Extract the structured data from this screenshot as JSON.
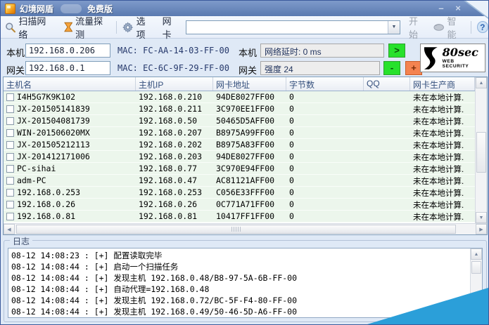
{
  "window": {
    "title": "幻境网盾",
    "edition": "免费版"
  },
  "icons": {
    "minimize": "–",
    "close": "×",
    "dropdown": "▼",
    "up": "▲",
    "down": "▼",
    "left": "◀",
    "right": "▶"
  },
  "toolbar": {
    "scan_label": "扫描网络",
    "traffic_label": "流量探测",
    "options_label": "选项",
    "nic_label": "网卡",
    "nic_combo_value": "",
    "start_label": "开始",
    "smart_label": "智能",
    "help_label": "?"
  },
  "info": {
    "local_label": "本机",
    "local_ip": "192.168.0.206",
    "local_mac": "MAC: FC-AA-14-03-FF-00",
    "gateway_label": "网关",
    "gateway_ip": "192.168.0.1",
    "gateway_mac": "MAC: EC-6C-9F-29-FF-00",
    "latency_owner_label": "本机",
    "latency_text": "网络延时: 0 ms",
    "go_button": ">",
    "strength_owner_label": "网关",
    "strength_text": "强度 24",
    "minus_button": "-",
    "plus_button": "+",
    "logo_text": "80sec",
    "logo_sub": "WEB SECURITY"
  },
  "table": {
    "columns": [
      "主机名",
      "主机IP",
      "网卡地址",
      "字节数",
      "QQ",
      "网卡生产商"
    ],
    "rows": [
      {
        "host": "I4H5G7K9K102",
        "ip": "192.168.0.210",
        "mac": "94DE8027FF00",
        "bytes": "0",
        "qq": "",
        "vendor": "未在本地计算."
      },
      {
        "host": "JX-201505141839",
        "ip": "192.168.0.211",
        "mac": "3C970EE1FF00",
        "bytes": "0",
        "qq": "",
        "vendor": "未在本地计算."
      },
      {
        "host": "JX-201504081739",
        "ip": "192.168.0.50",
        "mac": "50465D5AFF00",
        "bytes": "0",
        "qq": "",
        "vendor": "未在本地计算."
      },
      {
        "host": "WIN-201506020MX",
        "ip": "192.168.0.207",
        "mac": "B8975A99FF00",
        "bytes": "0",
        "qq": "",
        "vendor": "未在本地计算."
      },
      {
        "host": "JX-201505212113",
        "ip": "192.168.0.202",
        "mac": "B8975A83FF00",
        "bytes": "0",
        "qq": "",
        "vendor": "未在本地计算."
      },
      {
        "host": "JX-201412171006",
        "ip": "192.168.0.203",
        "mac": "94DE8027FF00",
        "bytes": "0",
        "qq": "",
        "vendor": "未在本地计算."
      },
      {
        "host": "PC-sihai",
        "ip": "192.168.0.77",
        "mac": "3C970E94FF00",
        "bytes": "0",
        "qq": "",
        "vendor": "未在本地计算."
      },
      {
        "host": "adm-PC",
        "ip": "192.168.0.47",
        "mac": "AC81121AFF00",
        "bytes": "0",
        "qq": "",
        "vendor": "未在本地计算."
      },
      {
        "host": "192.168.0.253",
        "ip": "192.168.0.253",
        "mac": "C056E33FFF00",
        "bytes": "0",
        "qq": "",
        "vendor": "未在本地计算."
      },
      {
        "host": "192.168.0.26",
        "ip": "192.168.0.26",
        "mac": "0C771A71FF00",
        "bytes": "0",
        "qq": "",
        "vendor": "未在本地计算."
      },
      {
        "host": "192.168.0.81",
        "ip": "192.168.0.81",
        "mac": "10417FF1FF00",
        "bytes": "0",
        "qq": "",
        "vendor": "未在本地计算."
      }
    ]
  },
  "log": {
    "title": "日志",
    "entries": [
      "08-12 14:08:23 : [+] 配置读取完毕",
      "08-12 14:08:44 : [+] 启动一个扫描任务",
      "08-12 14:08:44 : [+] 发现主机 192.168.0.48/B8-97-5A-6B-FF-00",
      "08-12 14:08:44 : [+] 自动代理=192.168.0.48",
      "08-12 14:08:44 : [+] 发现主机 192.168.0.72/BC-5F-F4-80-FF-00",
      "08-12 14:08:44 : [+] 发现主机 192.168.0.49/50-46-5D-A6-FF-00"
    ]
  }
}
